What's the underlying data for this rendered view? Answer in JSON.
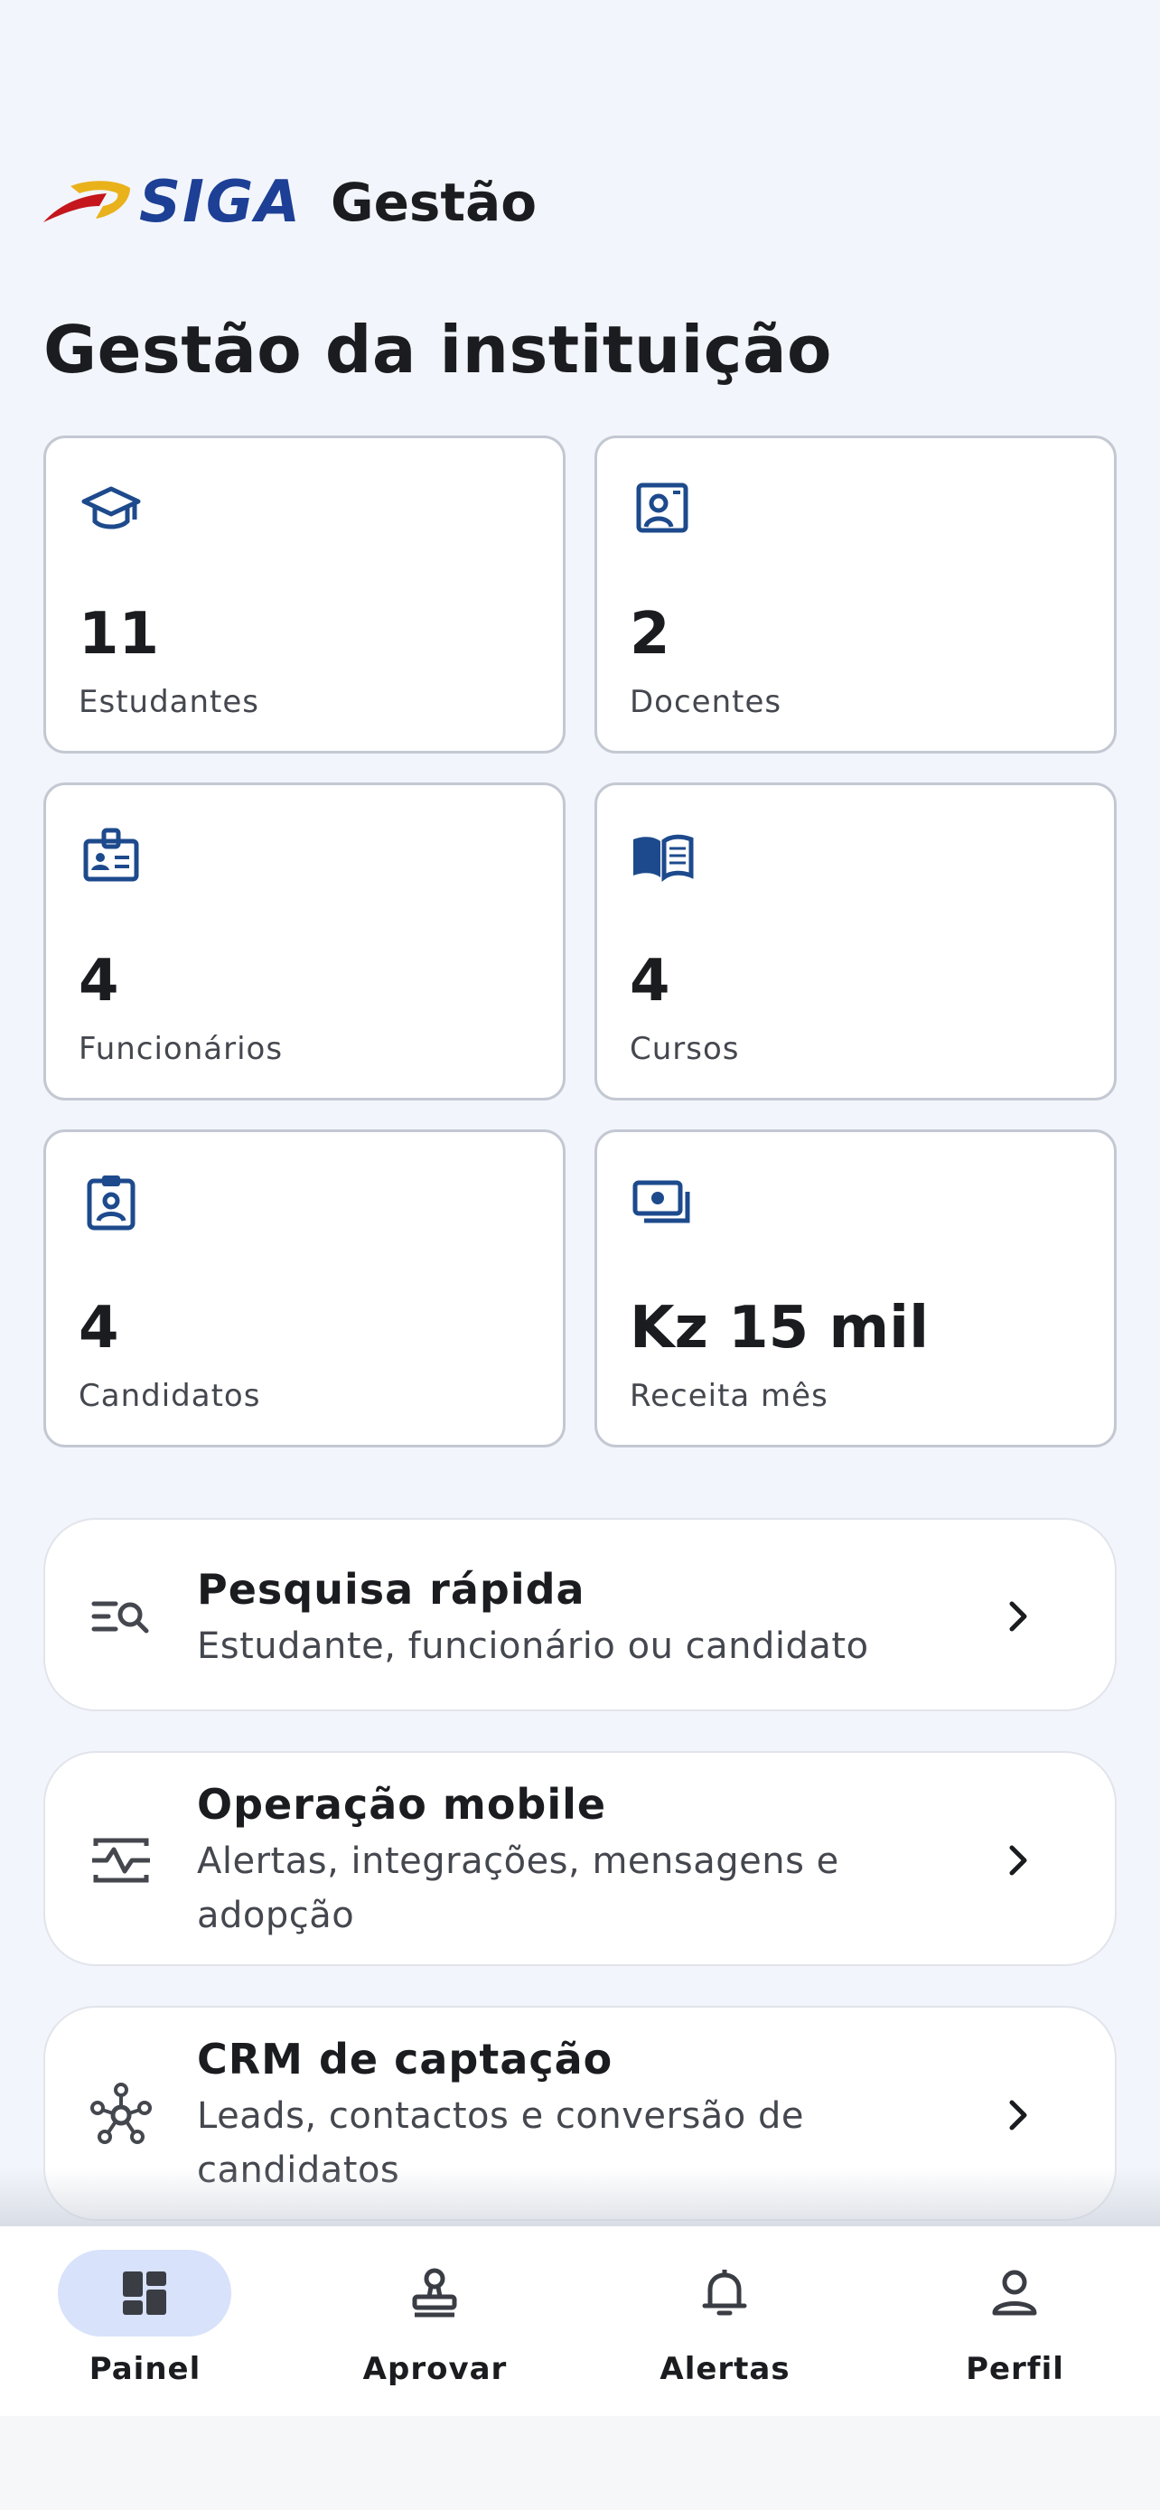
{
  "header": {
    "brand_text": "SIGA",
    "app_title": "Gestão"
  },
  "page_title": "Gestão da instituição",
  "stats": [
    {
      "icon": "graduation-cap-icon",
      "value": "11",
      "label": "Estudantes"
    },
    {
      "icon": "teacher-badge-icon",
      "value": "2",
      "label": "Docentes"
    },
    {
      "icon": "employee-id-icon",
      "value": "4",
      "label": "Funcionários"
    },
    {
      "icon": "open-book-icon",
      "value": "4",
      "label": "Cursos"
    },
    {
      "icon": "candidate-clipboard-icon",
      "value": "4",
      "label": "Candidatos"
    },
    {
      "icon": "money-icon",
      "value": "Kz  15 mil",
      "label": "Receita mês"
    }
  ],
  "actions": [
    {
      "icon": "search-list-icon",
      "title": "Pesquisa rápida",
      "subtitle": "Estudante, funcionário ou candidato"
    },
    {
      "icon": "monitor-heart-icon",
      "title": "Operação mobile",
      "subtitle": "Alertas, integrações, mensagens e adopção"
    },
    {
      "icon": "network-hub-icon",
      "title": "CRM de captação",
      "subtitle": "Leads, contactos e conversão de candidatos"
    }
  ],
  "nav": [
    {
      "icon": "dashboard-icon",
      "label": "Painel",
      "active": true
    },
    {
      "icon": "approve-stamp-icon",
      "label": "Aprovar",
      "active": false
    },
    {
      "icon": "bell-icon",
      "label": "Alertas",
      "active": false
    },
    {
      "icon": "person-icon",
      "label": "Perfil",
      "active": false
    }
  ],
  "colors": {
    "background": "#f2f5fb",
    "accent_blue": "#1d4a8c",
    "brand_navy": "#1d3f95",
    "brand_yellow": "#e9b21b",
    "brand_red": "#c4161c",
    "nav_active_pill": "#d8e2fb"
  }
}
